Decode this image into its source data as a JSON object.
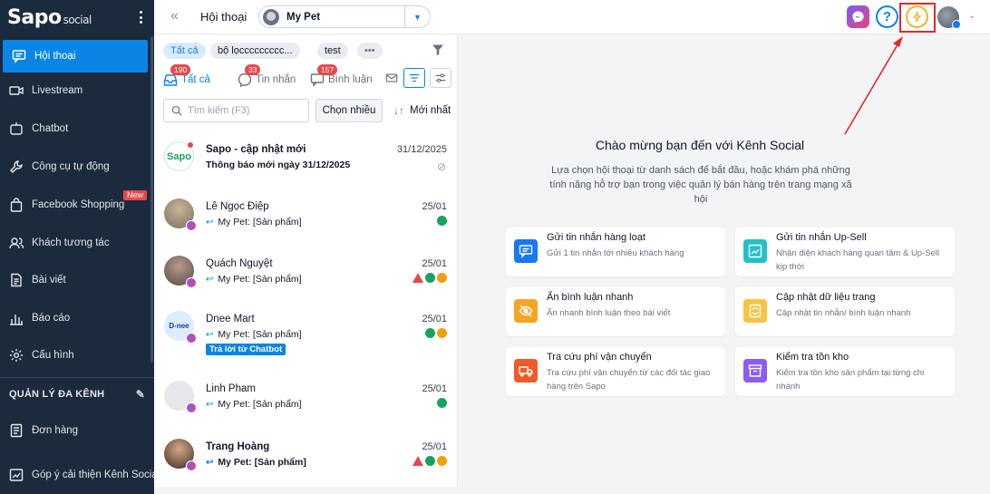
{
  "brand": {
    "logo": "Sapo",
    "suffix": "social"
  },
  "sidebar": {
    "items": [
      {
        "label": "Hội thoại",
        "icon": "chat-icon",
        "active": true
      },
      {
        "label": "Livestream",
        "icon": "video-icon"
      },
      {
        "label": "Chatbot",
        "icon": "robot-icon"
      },
      {
        "label": "Công cụ tự động",
        "icon": "wrench-icon"
      },
      {
        "label": "Facebook Shopping",
        "icon": "shopping-bag-icon",
        "badge": "New"
      },
      {
        "label": "Khách tương tác",
        "icon": "users-icon"
      },
      {
        "label": "Bài viết",
        "icon": "document-icon"
      },
      {
        "label": "Báo cáo",
        "icon": "bar-chart-icon"
      },
      {
        "label": "Cấu hình",
        "icon": "gear-icon"
      }
    ],
    "section_title": "QUẢN LÝ ĐA KÊNH",
    "section_items": [
      {
        "label": "Đơn hàng",
        "icon": "order-icon"
      },
      {
        "label": "Góp ý cải thiện Kênh Social",
        "icon": "feedback-icon"
      }
    ]
  },
  "header": {
    "title": "Hội thoại",
    "page_selector": "My Pet"
  },
  "list": {
    "chips": [
      "Tất cả",
      "bộ lọccccccccc...",
      "test",
      "•••"
    ],
    "tabs": [
      {
        "label": "Tất cả",
        "count": "190"
      },
      {
        "label": "Tin nhắn",
        "count": "33"
      },
      {
        "label": "Bình luận",
        "count": "157"
      }
    ],
    "search_placeholder": "Tìm kiếm (F3)",
    "choose_many": "Chọn nhiều",
    "sort": "Mới nhất",
    "conversations": [
      {
        "name": "Sapo - cập nhật mới",
        "date": "31/12/2025",
        "preview": "Thông báo mới ngày 31/12/2025",
        "avatar_text": "Sapo"
      },
      {
        "name": "Lê Ngọc Điệp",
        "date": "25/01",
        "preview": "My Pet: [Sản phẩm]"
      },
      {
        "name": "Quách Nguyệt",
        "date": "25/01",
        "preview": "My Pet: [Sản phẩm]"
      },
      {
        "name": "Dnee Mart",
        "date": "25/01",
        "preview": "My Pet: [Sản phẩm]",
        "tag": "Trả lời từ Chatbot",
        "avatar_text": "D-nee"
      },
      {
        "name": "Linh Pham",
        "date": "25/01",
        "preview": "My Pet: [Sản phẩm]"
      },
      {
        "name": "Trang Hoàng",
        "date": "25/01",
        "preview": "My Pet: [Sản phẩm]"
      }
    ]
  },
  "welcome": {
    "title": "Chào mừng bạn đến với Kênh Social",
    "desc": "Lựa chọn hội thoại từ danh sách để bắt đầu, hoặc khám phá những tính năng hỗ trợ bạn trong việc quản lý bán hàng trên trang mạng xã hội",
    "cards": [
      {
        "title": "Gửi tin nhắn hàng loạt",
        "desc": "Gửi 1 tin nhắn tới nhiều khách hàng",
        "color": "#1877f2",
        "icon": "broadcast-icon"
      },
      {
        "title": "Gửi tin nhắn Up-Sell",
        "desc": "Nhận diện khách hàng quan tâm & Up-Sell kịp thời",
        "color": "#22c0c9",
        "icon": "trend-icon"
      },
      {
        "title": "Ẩn bình luận nhanh",
        "desc": "Ẩn nhanh bình luận theo bài viết",
        "color": "#f5a623",
        "icon": "eye-off-icon"
      },
      {
        "title": "Cập nhật dữ liệu trang",
        "desc": "Cập nhật tin nhắn/ bình luận nhanh",
        "color": "#f6c343",
        "icon": "sync-icon"
      },
      {
        "title": "Tra cứu phí vận chuyển",
        "desc": "Tra cứu phí vận chuyển từ các đối tác giao hàng trên Sapo",
        "color": "#f05a28",
        "icon": "truck-icon"
      },
      {
        "title": "Kiểm tra tồn kho",
        "desc": "Kiểm tra tồn kho sản phẩm tại từng chi nhánh",
        "color": "#8b5cf6",
        "icon": "archive-icon"
      }
    ]
  },
  "colors": {
    "primary": "#0a85e6",
    "sidebar": "#1b2a3c",
    "highlight": "#e0292b"
  }
}
